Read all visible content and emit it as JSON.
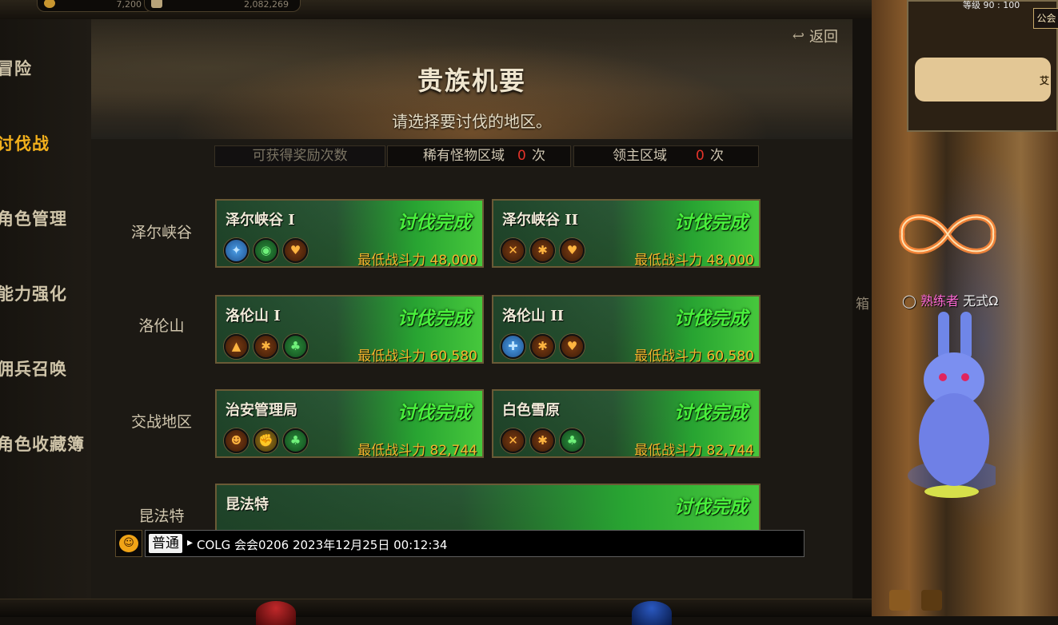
{
  "top": {
    "gold": "7,200",
    "coins": "2,082,269"
  },
  "nav": {
    "items": [
      "冒险",
      "讨伐战",
      "角色管理",
      "能力强化",
      "佣兵召唤",
      "角色收藏簿"
    ],
    "active_index": 1
  },
  "header": {
    "title": "贵族机要",
    "subtitle": "请选择要讨伐的地区。",
    "back_label": "返回"
  },
  "rewards": {
    "label": "可获得奖励次数",
    "rare_label": "稀有怪物区域",
    "rare_count": "0",
    "lord_label": "领主区域",
    "lord_count": "0",
    "unit": "次"
  },
  "regions": [
    {
      "name": "泽尔峡谷",
      "dungeons": [
        {
          "name": "泽尔峡谷 I",
          "status": "讨伐完成",
          "power": "最低战斗力 48,000",
          "icons": [
            "wing-monster-icon",
            "eye-icon",
            "heart-icon"
          ]
        },
        {
          "name": "泽尔峡谷 II",
          "status": "讨伐完成",
          "power": "最低战斗力 48,000",
          "icons": [
            "crossed-swords-icon",
            "torch-icon",
            "heart-icon"
          ]
        }
      ]
    },
    {
      "name": "洛伦山",
      "dungeons": [
        {
          "name": "洛伦山 I",
          "status": "讨伐完成",
          "power": "最低战斗力 60,580",
          "icons": [
            "armor-icon",
            "torch-icon",
            "clover-icon"
          ]
        },
        {
          "name": "洛伦山 II",
          "status": "讨伐完成",
          "power": "最低战斗力 60,580",
          "icons": [
            "guardian-icon",
            "torch-icon",
            "heart-icon"
          ]
        }
      ]
    },
    {
      "name": "交战地区",
      "dungeons": [
        {
          "name": "治安管理局",
          "status": "讨伐完成",
          "power": "最低战斗力 82,744",
          "icons": [
            "mask-icon",
            "fist-icon",
            "clover-icon"
          ]
        },
        {
          "name": "白色雪原",
          "status": "讨伐完成",
          "power": "最低战斗力 82,744",
          "icons": [
            "crossed-swords-icon",
            "torch-icon",
            "clover-icon"
          ]
        }
      ]
    },
    {
      "name": "昆法特",
      "dungeons": [
        {
          "name": "昆法特",
          "status": "讨伐完成",
          "power": "",
          "icons": []
        }
      ]
    }
  ],
  "chat": {
    "channel": "普通",
    "input_value": "COLG 会会0206 2023年12月25日 00:12:34"
  },
  "scene": {
    "level": "等级 90 : 100",
    "guild": "公会",
    "place": "艾",
    "player_title": "熟练者",
    "player_name": "无式Ω",
    "box_label": "箱"
  },
  "colors": {
    "active_nav": "#f2b01c",
    "done_green": "#49f03c",
    "power_orange": "#f6b52e",
    "count_red": "#e5332a"
  }
}
